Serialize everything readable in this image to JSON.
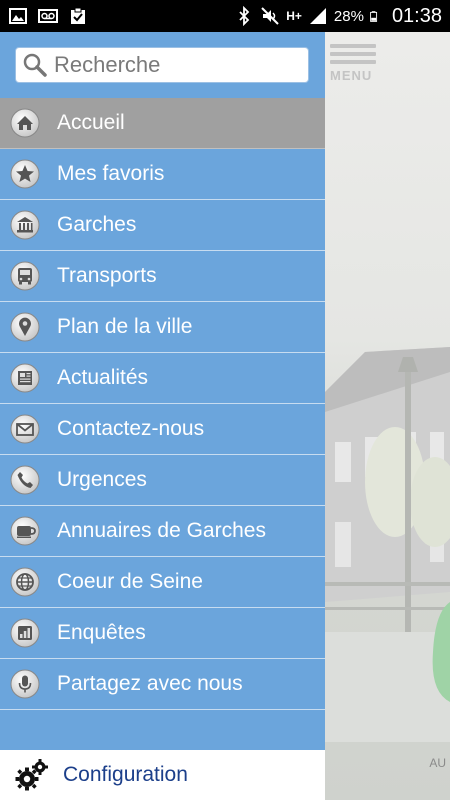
{
  "status_bar": {
    "battery_percent": "28%",
    "time": "01:38",
    "network": "H+",
    "left_icons": [
      "image-icon",
      "voicemail-icon",
      "clipboard-check-icon"
    ],
    "right_icons": [
      "bluetooth-icon",
      "mute-icon",
      "signal-icon",
      "battery-icon"
    ]
  },
  "drawer": {
    "search": {
      "placeholder": "Recherche"
    },
    "items": [
      {
        "label": "Accueil",
        "icon": "home-icon",
        "active": true
      },
      {
        "label": "Mes favoris",
        "icon": "star-icon"
      },
      {
        "label": "Garches",
        "icon": "city-hall-icon"
      },
      {
        "label": "Transports",
        "icon": "bus-icon"
      },
      {
        "label": "Plan de la ville",
        "icon": "map-pin-icon"
      },
      {
        "label": "Actualités",
        "icon": "newspaper-icon"
      },
      {
        "label": "Contactez-nous",
        "icon": "envelope-icon"
      },
      {
        "label": "Urgences",
        "icon": "phone-icon"
      },
      {
        "label": "Annuaires de Garches",
        "icon": "directory-icon"
      },
      {
        "label": "Coeur de Seine",
        "icon": "globe-icon"
      },
      {
        "label": "Enquêtes",
        "icon": "poll-icon"
      },
      {
        "label": "Partagez avec nous",
        "icon": "microphone-icon"
      }
    ],
    "footer": {
      "label": "Configuration",
      "icon": "gear-icon"
    }
  },
  "background_app": {
    "menu_label": "MENU",
    "footer_text": "AU"
  },
  "colors": {
    "drawer_bg": "#6ba5dc",
    "active_item_bg": "#a0a0a0",
    "config_text": "#1c3f8a"
  }
}
